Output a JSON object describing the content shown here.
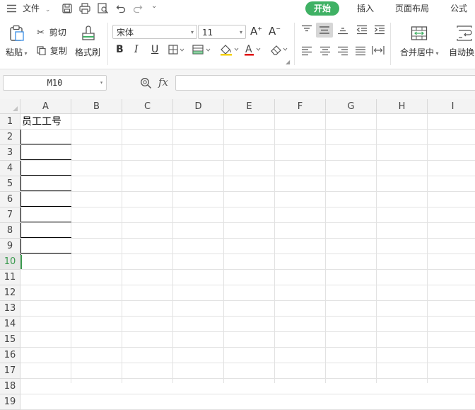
{
  "menubar": {
    "file_label": "文件",
    "tabs": [
      {
        "label": "开始",
        "active": true
      },
      {
        "label": "插入",
        "active": false
      },
      {
        "label": "页面布局",
        "active": false
      },
      {
        "label": "公式",
        "active": false
      }
    ]
  },
  "ribbon": {
    "paste_label": "粘贴",
    "cut_label": "剪切",
    "copy_label": "复制",
    "format_painter_label": "格式刷",
    "font_name": "宋体",
    "font_size": "11",
    "merge_center_label": "合并居中",
    "wrap_label": "自动换"
  },
  "formula_bar": {
    "name_box": "M10",
    "fx_label": "fx",
    "formula": ""
  },
  "sheet": {
    "columns": [
      "A",
      "B",
      "C",
      "D",
      "E",
      "F",
      "G",
      "H",
      "I"
    ],
    "rows": [
      "1",
      "2",
      "3",
      "4",
      "5",
      "6",
      "7",
      "8",
      "9",
      "10",
      "11",
      "12",
      "13",
      "14",
      "15",
      "16",
      "17",
      "18",
      "19"
    ],
    "active_row": "10",
    "cells": {
      "A1": "员工工号"
    }
  },
  "colors": {
    "accent": "#3fb164",
    "active_row_header": "#3a9a4e"
  }
}
